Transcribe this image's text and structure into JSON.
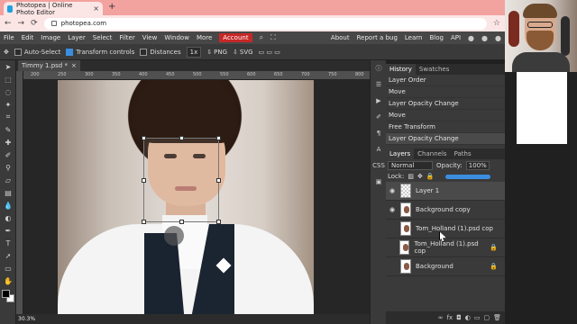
{
  "browser": {
    "tab_title": "Photopea | Online Photo Editor",
    "tab_close": "×",
    "new_tab": "+",
    "url": "photopea.com",
    "nav": [
      "←",
      "→",
      "⟳"
    ],
    "star": "☆"
  },
  "menu": {
    "items": [
      "File",
      "Edit",
      "Image",
      "Layer",
      "Select",
      "Filter",
      "View",
      "Window",
      "More"
    ],
    "account": "Account",
    "right_items": [
      "About",
      "Report a bug",
      "Learn",
      "Blog",
      "API"
    ]
  },
  "options": {
    "auto_select": "Auto-Select",
    "transform_controls": "Transform controls",
    "distances": "Distances",
    "scale": "1x",
    "png": "PNG",
    "svg": "SVG"
  },
  "document": {
    "tab_name": "Timmy 1.psd *",
    "tab_close": "×",
    "zoom": "30.3%",
    "ruler_ticks": [
      "200",
      "250",
      "300",
      "350",
      "400",
      "450",
      "500",
      "550",
      "600",
      "650",
      "700",
      "750",
      "800"
    ]
  },
  "history": {
    "tabs": [
      "History",
      "Swatches"
    ],
    "items": [
      "Layer Order",
      "Move",
      "Layer Opacity Change",
      "Move",
      "Free Transform",
      "Layer Opacity Change"
    ],
    "selected_index": 5
  },
  "layers": {
    "tabs": [
      "Layers",
      "Channels",
      "Paths"
    ],
    "blend_mode": "Normal",
    "opacity_label": "Opacity:",
    "opacity_value": "100%",
    "lock_label": "Lock:",
    "rows": [
      {
        "name": "Layer 1",
        "visible": true,
        "locked": false,
        "selected": true
      },
      {
        "name": "Background copy",
        "visible": true,
        "locked": false,
        "selected": false
      },
      {
        "name": "Tom_Holland (1).psd cop",
        "visible": false,
        "locked": false,
        "selected": false
      },
      {
        "name": "Tom_Holland (1).psd cop",
        "visible": false,
        "locked": true,
        "selected": false
      },
      {
        "name": "Background",
        "visible": false,
        "locked": true,
        "selected": false
      }
    ],
    "footer_icons": [
      "link-icon",
      "fx-icon",
      "mask-icon",
      "adjustment-icon",
      "folder-icon",
      "new-layer-icon",
      "trash-icon"
    ]
  },
  "colors": {
    "tab_bar": "#f2a29f",
    "account": "#c62828",
    "accent": "#3b8de0"
  }
}
